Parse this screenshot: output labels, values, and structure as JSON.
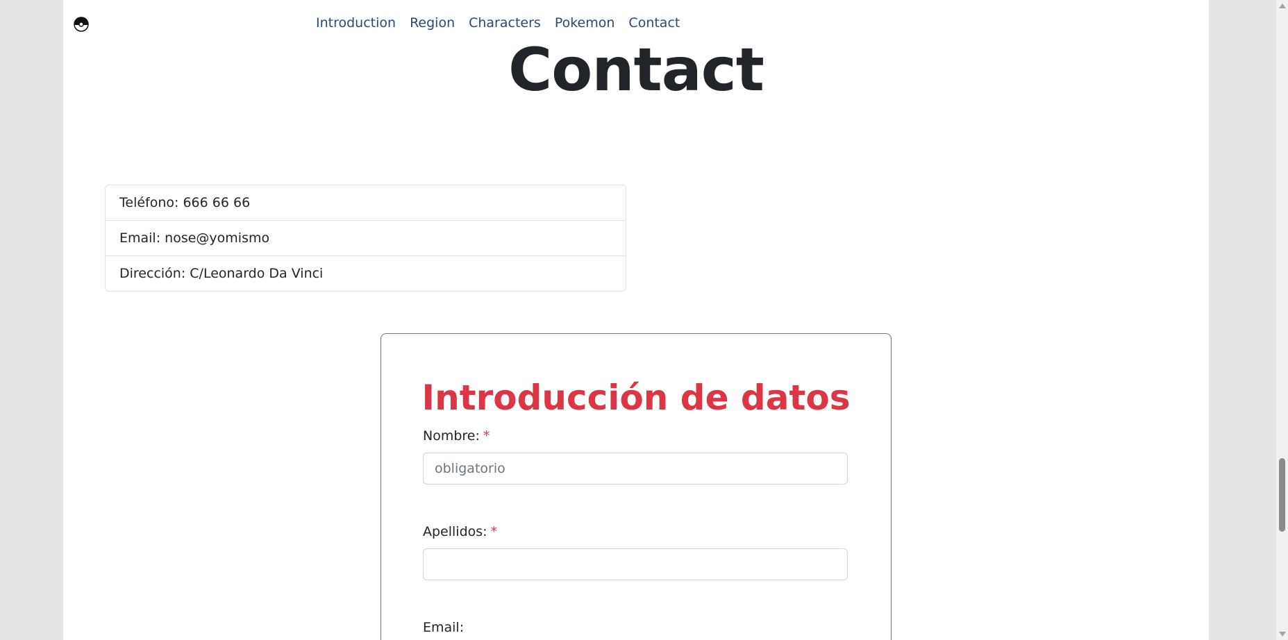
{
  "nav": {
    "logo_icon": "pokeball-icon",
    "items": [
      "Introduction",
      "Region",
      "Characters",
      "Pokemon",
      "Contact"
    ]
  },
  "page": {
    "title": "Contact"
  },
  "contact_info": {
    "items": [
      "Teléfono: 666 66 66",
      "Email: nose@yomismo",
      "Dirección: C/Leonardo Da Vinci"
    ]
  },
  "form": {
    "title": "Introducción de datos",
    "fields": [
      {
        "label": "Nombre:",
        "required_mark": "*",
        "placeholder": "obligatorio",
        "value": ""
      },
      {
        "label": "Apellidos:",
        "required_mark": "*",
        "placeholder": "",
        "value": ""
      },
      {
        "label": "Email:"
      }
    ]
  },
  "colors": {
    "nav_link": "#2b4a73",
    "form_title": "#dc3545",
    "required_mark": "#dc3545",
    "page_background": "#e3e4e6"
  }
}
